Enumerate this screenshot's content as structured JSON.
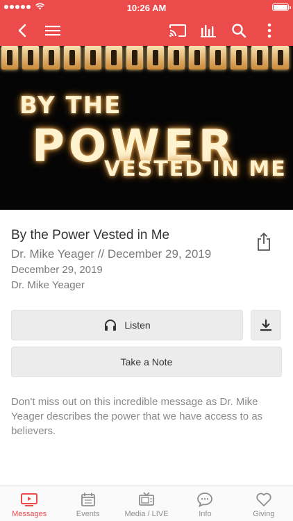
{
  "status_bar": {
    "time": "10:26 AM"
  },
  "nav": {
    "icons": [
      "back-chevron-icon",
      "menu-icon",
      "cast-icon",
      "audio-bars-icon",
      "search-icon",
      "more-vertical-icon"
    ]
  },
  "hero": {
    "line1": "BY THE",
    "line2": "POWER",
    "line3": "VESTED IN ME"
  },
  "message": {
    "title": "By the Power Vested in Me",
    "subtitle": "Dr. Mike Yeager // December 29, 2019",
    "date": "December 29, 2019",
    "speaker": "Dr. Mike Yeager",
    "description": "Don't miss out on this incredible message as Dr. Mike Yeager describes the power that we have access to as believers."
  },
  "actions": {
    "listen_label": "Listen",
    "note_label": "Take a Note"
  },
  "tabs": [
    {
      "label": "Messages",
      "icon": "tv-play-icon",
      "active": true
    },
    {
      "label": "Events",
      "icon": "calendar-icon",
      "active": false
    },
    {
      "label": "Media / LIVE",
      "icon": "tv-icon",
      "active": false
    },
    {
      "label": "Info",
      "icon": "chat-bubble-icon",
      "active": false
    },
    {
      "label": "Giving",
      "icon": "heart-icon",
      "active": false
    }
  ],
  "colors": {
    "accent": "#ec4b4b",
    "tab_inactive": "#8e8e8e",
    "button_bg": "#ececec"
  }
}
